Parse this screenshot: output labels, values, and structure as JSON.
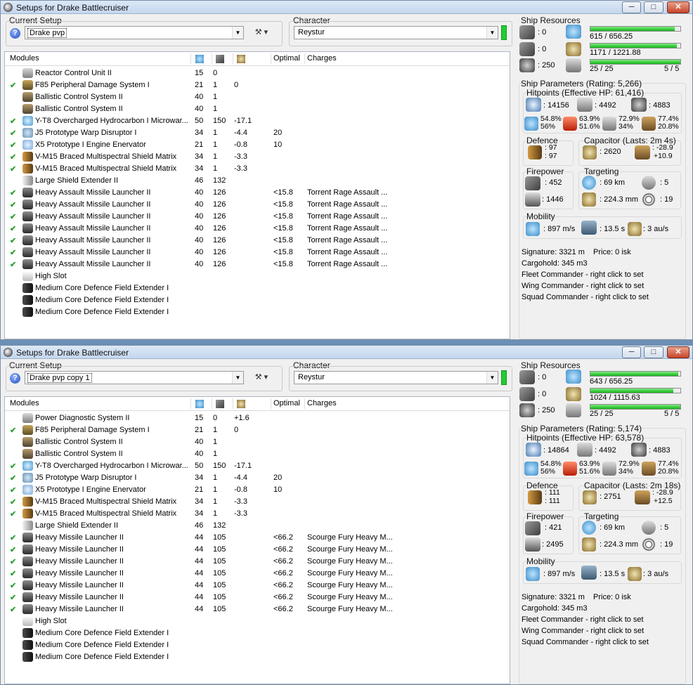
{
  "windows": [
    {
      "title": "Setups for Drake Battlecruiser",
      "buttons": {
        "minimize": "─",
        "maximize": "□",
        "close": "✕"
      },
      "current_setup_label": "Current Setup",
      "setup_value": "Drake pvp",
      "character_label": "Character",
      "character_value": "Reystur",
      "modules_header": {
        "name": "Modules",
        "optimal": "Optimal",
        "charges": "Charges"
      },
      "modules": [
        {
          "check": "",
          "icon": "reactor-control-icon",
          "name": "Reactor Control Unit II",
          "c1": "15",
          "c2": "0",
          "c3": "",
          "optimal": "",
          "charges": ""
        },
        {
          "check": "✔",
          "icon": "damage-system-icon",
          "name": "F85 Peripheral Damage System I",
          "c1": "21",
          "c2": "1",
          "c3": "0",
          "optimal": "",
          "charges": ""
        },
        {
          "check": "",
          "icon": "ballistic-control-icon",
          "name": "Ballistic Control System II",
          "c1": "40",
          "c2": "1",
          "c3": "",
          "optimal": "",
          "charges": ""
        },
        {
          "check": "",
          "icon": "ballistic-control-icon",
          "name": "Ballistic Control System II",
          "c1": "40",
          "c2": "1",
          "c3": "",
          "optimal": "",
          "charges": ""
        },
        {
          "check": "✔",
          "icon": "microwarpdrive-icon",
          "name": "Y-T8 Overcharged Hydrocarbon I Microwar...",
          "c1": "50",
          "c2": "150",
          "c3": "-17.1",
          "optimal": "",
          "charges": ""
        },
        {
          "check": "✔",
          "icon": "warp-disruptor-icon",
          "name": "J5 Prototype Warp Disruptor I",
          "c1": "34",
          "c2": "1",
          "c3": "-4.4",
          "optimal": "20",
          "charges": ""
        },
        {
          "check": "✔",
          "icon": "web-icon",
          "name": "X5 Prototype I Engine Enervator",
          "c1": "21",
          "c2": "1",
          "c3": "-0.8",
          "optimal": "10",
          "charges": ""
        },
        {
          "check": "✔",
          "icon": "shield-matrix-icon",
          "name": "V-M15 Braced Multispectral Shield Matrix",
          "c1": "34",
          "c2": "1",
          "c3": "-3.3",
          "optimal": "",
          "charges": ""
        },
        {
          "check": "✔",
          "icon": "shield-matrix-icon",
          "name": "V-M15 Braced Multispectral Shield Matrix",
          "c1": "34",
          "c2": "1",
          "c3": "-3.3",
          "optimal": "",
          "charges": ""
        },
        {
          "check": "",
          "icon": "shield-extender-icon",
          "name": "Large Shield Extender II",
          "c1": "46",
          "c2": "132",
          "c3": "",
          "optimal": "",
          "charges": ""
        },
        {
          "check": "✔",
          "icon": "missile-launcher-icon",
          "name": "Heavy Assault Missile Launcher II",
          "c1": "40",
          "c2": "126",
          "c3": "",
          "optimal": "<15.8",
          "charges": "Torrent Rage Assault ..."
        },
        {
          "check": "✔",
          "icon": "missile-launcher-icon",
          "name": "Heavy Assault Missile Launcher II",
          "c1": "40",
          "c2": "126",
          "c3": "",
          "optimal": "<15.8",
          "charges": "Torrent Rage Assault ..."
        },
        {
          "check": "✔",
          "icon": "missile-launcher-icon",
          "name": "Heavy Assault Missile Launcher II",
          "c1": "40",
          "c2": "126",
          "c3": "",
          "optimal": "<15.8",
          "charges": "Torrent Rage Assault ..."
        },
        {
          "check": "✔",
          "icon": "missile-launcher-icon",
          "name": "Heavy Assault Missile Launcher II",
          "c1": "40",
          "c2": "126",
          "c3": "",
          "optimal": "<15.8",
          "charges": "Torrent Rage Assault ..."
        },
        {
          "check": "✔",
          "icon": "missile-launcher-icon",
          "name": "Heavy Assault Missile Launcher II",
          "c1": "40",
          "c2": "126",
          "c3": "",
          "optimal": "<15.8",
          "charges": "Torrent Rage Assault ..."
        },
        {
          "check": "✔",
          "icon": "missile-launcher-icon",
          "name": "Heavy Assault Missile Launcher II",
          "c1": "40",
          "c2": "126",
          "c3": "",
          "optimal": "<15.8",
          "charges": "Torrent Rage Assault ..."
        },
        {
          "check": "✔",
          "icon": "missile-launcher-icon",
          "name": "Heavy Assault Missile Launcher II",
          "c1": "40",
          "c2": "126",
          "c3": "",
          "optimal": "<15.8",
          "charges": "Torrent Rage Assault ..."
        },
        {
          "check": "",
          "icon": "high-slot-icon",
          "name": "High Slot",
          "c1": "",
          "c2": "",
          "c3": "",
          "optimal": "",
          "charges": ""
        },
        {
          "check": "",
          "icon": "rig-icon",
          "name": "Medium Core Defence Field Extender I",
          "c1": "",
          "c2": "",
          "c3": "",
          "optimal": "",
          "charges": ""
        },
        {
          "check": "",
          "icon": "rig-icon",
          "name": "Medium Core Defence Field Extender I",
          "c1": "",
          "c2": "",
          "c3": "",
          "optimal": "",
          "charges": ""
        },
        {
          "check": "",
          "icon": "rig-icon",
          "name": "Medium Core Defence Field Extender I",
          "c1": "",
          "c2": "",
          "c3": "",
          "optimal": "",
          "charges": ""
        }
      ],
      "resources": {
        "label": "Ship Resources",
        "turret": ": 0",
        "launcher": ": 0",
        "drone": ": 250",
        "cpu": "615 / 656.25",
        "cpu_fill": 0.937,
        "power": "1171 / 1221.88",
        "power_fill": 0.958,
        "calib": "25 / 25",
        "rigs": "5 / 5",
        "calib_fill": 1.0
      },
      "params": {
        "label": "Ship Parameters (Rating: 5,266)",
        "hitpoints_label": "Hitpoints (Effective HP: 61,416)",
        "shield_hp": ": 14156",
        "armor_hp": ": 4492",
        "struct_hp": ": 4883",
        "res_em": [
          "54.8%",
          "56%"
        ],
        "res_th": [
          "63.9%",
          "51.6%"
        ],
        "res_ki": [
          "72.9%",
          "34%"
        ],
        "res_ex": [
          "77.4%",
          "20.8%"
        ],
        "defence_label": "Defence",
        "def1": ": 97",
        "def2": ": 97",
        "capacitor_label": "Capacitor (Lasts: 2m 4s)",
        "cap_amount": ": 2620",
        "cap1": ": -28.9",
        "cap2": "+10.9",
        "firepower_label": "Firepower",
        "fp1": ": 452",
        "fp2": ": 1446",
        "targeting_label": "Targeting",
        "t_range": ": 69 km",
        "t_targets": ": 5",
        "t_scan": ": 224.3 mm",
        "t_sig": ": 19",
        "mobility_label": "Mobility",
        "speed": ": 897 m/s",
        "align": ": 13.5 s",
        "warp": ": 3 au/s",
        "signature": "Signature: 3321 m",
        "price": "Price: 0 isk",
        "cargo": "Cargohold: 345 m3",
        "fleet": "Fleet Commander - right click to set",
        "wing": "Wing Commander - right click to set",
        "squad": "Squad Commander - right click to set"
      }
    },
    {
      "title": "Setups for Drake Battlecruiser",
      "buttons": {
        "minimize": "─",
        "maximize": "□",
        "close": "✕"
      },
      "current_setup_label": "Current Setup",
      "setup_value": "Drake pvp copy 1",
      "character_label": "Character",
      "character_value": "Reystur",
      "modules_header": {
        "name": "Modules",
        "optimal": "Optimal",
        "charges": "Charges"
      },
      "modules": [
        {
          "check": "",
          "icon": "power-diagnostic-icon",
          "name": "Power Diagnostic System II",
          "c1": "15",
          "c2": "0",
          "c3": "+1.6",
          "optimal": "",
          "charges": ""
        },
        {
          "check": "✔",
          "icon": "damage-system-icon",
          "name": "F85 Peripheral Damage System I",
          "c1": "21",
          "c2": "1",
          "c3": "0",
          "optimal": "",
          "charges": ""
        },
        {
          "check": "",
          "icon": "ballistic-control-icon",
          "name": "Ballistic Control System II",
          "c1": "40",
          "c2": "1",
          "c3": "",
          "optimal": "",
          "charges": ""
        },
        {
          "check": "",
          "icon": "ballistic-control-icon",
          "name": "Ballistic Control System II",
          "c1": "40",
          "c2": "1",
          "c3": "",
          "optimal": "",
          "charges": ""
        },
        {
          "check": "✔",
          "icon": "microwarpdrive-icon",
          "name": "Y-T8 Overcharged Hydrocarbon I Microwar...",
          "c1": "50",
          "c2": "150",
          "c3": "-17.1",
          "optimal": "",
          "charges": ""
        },
        {
          "check": "✔",
          "icon": "warp-disruptor-icon",
          "name": "J5 Prototype Warp Disruptor I",
          "c1": "34",
          "c2": "1",
          "c3": "-4.4",
          "optimal": "20",
          "charges": ""
        },
        {
          "check": "✔",
          "icon": "web-icon",
          "name": "X5 Prototype I Engine Enervator",
          "c1": "21",
          "c2": "1",
          "c3": "-0.8",
          "optimal": "10",
          "charges": ""
        },
        {
          "check": "✔",
          "icon": "shield-matrix-icon",
          "name": "V-M15 Braced Multispectral Shield Matrix",
          "c1": "34",
          "c2": "1",
          "c3": "-3.3",
          "optimal": "",
          "charges": ""
        },
        {
          "check": "✔",
          "icon": "shield-matrix-icon",
          "name": "V-M15 Braced Multispectral Shield Matrix",
          "c1": "34",
          "c2": "1",
          "c3": "-3.3",
          "optimal": "",
          "charges": ""
        },
        {
          "check": "",
          "icon": "shield-extender-icon",
          "name": "Large Shield Extender II",
          "c1": "46",
          "c2": "132",
          "c3": "",
          "optimal": "",
          "charges": ""
        },
        {
          "check": "✔",
          "icon": "missile-launcher-icon",
          "name": "Heavy Missile Launcher II",
          "c1": "44",
          "c2": "105",
          "c3": "",
          "optimal": "<66.2",
          "charges": "Scourge Fury Heavy M..."
        },
        {
          "check": "✔",
          "icon": "missile-launcher-icon",
          "name": "Heavy Missile Launcher II",
          "c1": "44",
          "c2": "105",
          "c3": "",
          "optimal": "<66.2",
          "charges": "Scourge Fury Heavy M..."
        },
        {
          "check": "✔",
          "icon": "missile-launcher-icon",
          "name": "Heavy Missile Launcher II",
          "c1": "44",
          "c2": "105",
          "c3": "",
          "optimal": "<66.2",
          "charges": "Scourge Fury Heavy M..."
        },
        {
          "check": "✔",
          "icon": "missile-launcher-icon",
          "name": "Heavy Missile Launcher II",
          "c1": "44",
          "c2": "105",
          "c3": "",
          "optimal": "<66.2",
          "charges": "Scourge Fury Heavy M..."
        },
        {
          "check": "✔",
          "icon": "missile-launcher-icon",
          "name": "Heavy Missile Launcher II",
          "c1": "44",
          "c2": "105",
          "c3": "",
          "optimal": "<66.2",
          "charges": "Scourge Fury Heavy M..."
        },
        {
          "check": "✔",
          "icon": "missile-launcher-icon",
          "name": "Heavy Missile Launcher II",
          "c1": "44",
          "c2": "105",
          "c3": "",
          "optimal": "<66.2",
          "charges": "Scourge Fury Heavy M..."
        },
        {
          "check": "✔",
          "icon": "missile-launcher-icon",
          "name": "Heavy Missile Launcher II",
          "c1": "44",
          "c2": "105",
          "c3": "",
          "optimal": "<66.2",
          "charges": "Scourge Fury Heavy M..."
        },
        {
          "check": "",
          "icon": "high-slot-icon",
          "name": "High Slot",
          "c1": "",
          "c2": "",
          "c3": "",
          "optimal": "",
          "charges": ""
        },
        {
          "check": "",
          "icon": "rig-icon",
          "name": "Medium Core Defence Field Extender I",
          "c1": "",
          "c2": "",
          "c3": "",
          "optimal": "",
          "charges": ""
        },
        {
          "check": "",
          "icon": "rig-icon",
          "name": "Medium Core Defence Field Extender I",
          "c1": "",
          "c2": "",
          "c3": "",
          "optimal": "",
          "charges": ""
        },
        {
          "check": "",
          "icon": "rig-icon",
          "name": "Medium Core Defence Field Extender I",
          "c1": "",
          "c2": "",
          "c3": "",
          "optimal": "",
          "charges": ""
        }
      ],
      "resources": {
        "label": "Ship Resources",
        "turret": ": 0",
        "launcher": ": 0",
        "drone": ": 250",
        "cpu": "643 / 656.25",
        "cpu_fill": 0.98,
        "power": "1024 / 1115.63",
        "power_fill": 0.918,
        "calib": "25 / 25",
        "rigs": "5 / 5",
        "calib_fill": 1.0
      },
      "params": {
        "label": "Ship Parameters (Rating: 5,174)",
        "hitpoints_label": "Hitpoints (Effective HP: 63,578)",
        "shield_hp": ": 14864",
        "armor_hp": ": 4492",
        "struct_hp": ": 4883",
        "res_em": [
          "54.8%",
          "56%"
        ],
        "res_th": [
          "63.9%",
          "51.6%"
        ],
        "res_ki": [
          "72.9%",
          "34%"
        ],
        "res_ex": [
          "77.4%",
          "20.8%"
        ],
        "defence_label": "Defence",
        "def1": ": 111",
        "def2": ": 111",
        "capacitor_label": "Capacitor (Lasts: 2m 18s)",
        "cap_amount": ": 2751",
        "cap1": ": -28.9",
        "cap2": "+12.5",
        "firepower_label": "Firepower",
        "fp1": ": 421",
        "fp2": ": 2495",
        "targeting_label": "Targeting",
        "t_range": ": 69 km",
        "t_targets": ": 5",
        "t_scan": ": 224.3 mm",
        "t_sig": ": 19",
        "mobility_label": "Mobility",
        "speed": ": 897 m/s",
        "align": ": 13.5 s",
        "warp": ": 3 au/s",
        "signature": "Signature: 3321 m",
        "price": "Price: 0 isk",
        "cargo": "Cargohold: 345 m3",
        "fleet": "Fleet Commander - right click to set",
        "wing": "Wing Commander - right click to set",
        "squad": "Squad Commander - right click to set"
      }
    }
  ]
}
